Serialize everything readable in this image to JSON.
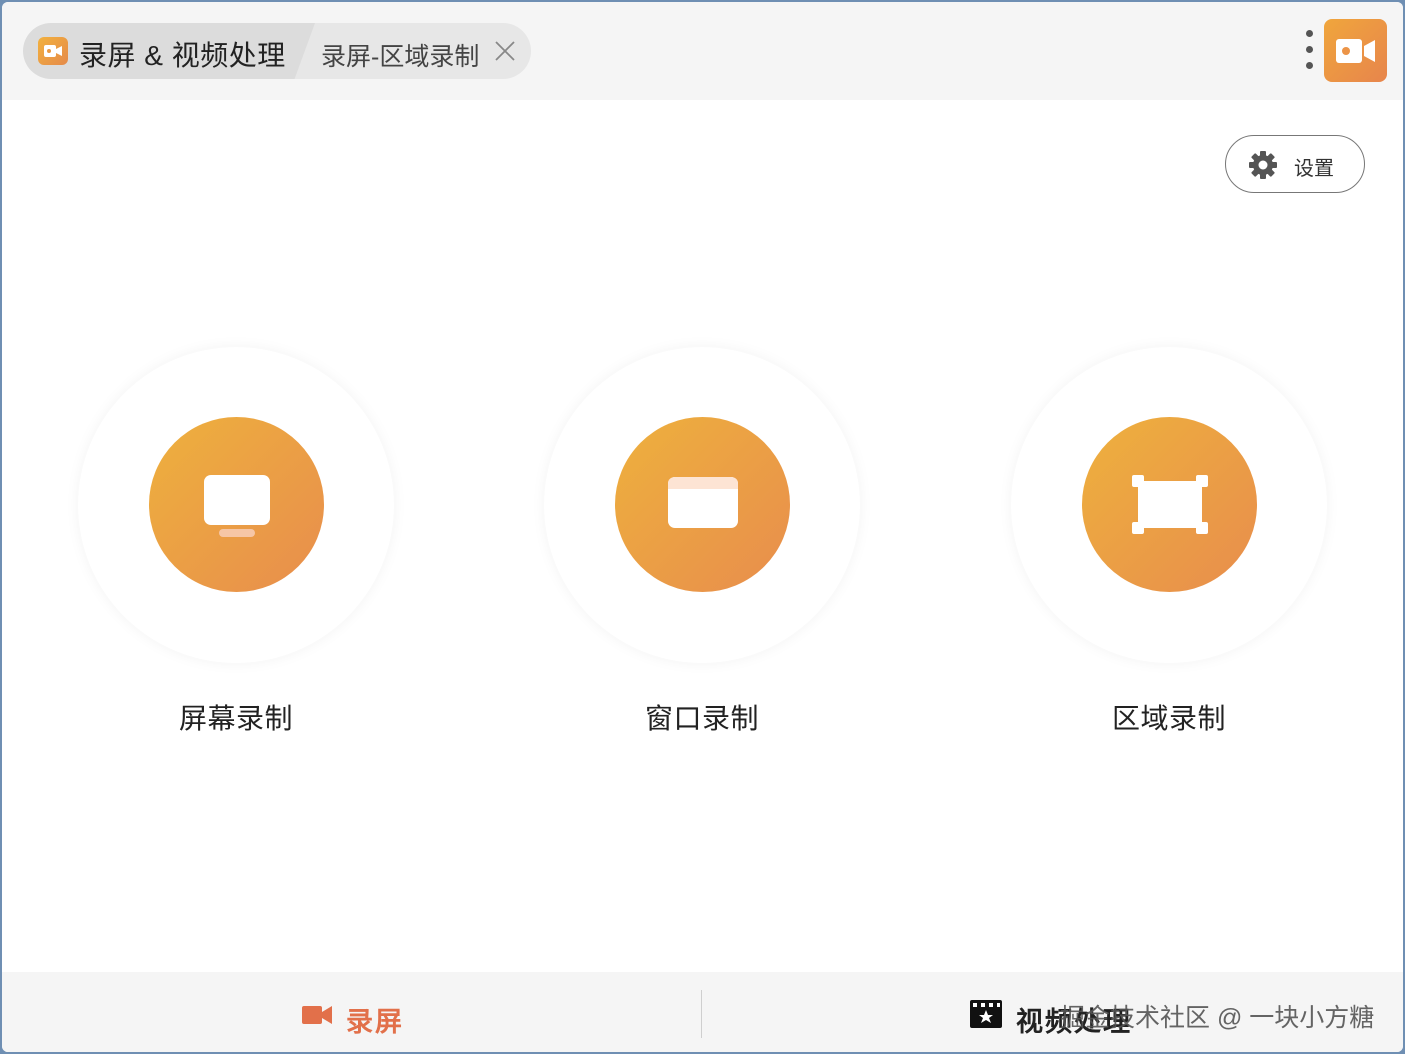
{
  "header": {
    "main_tab_label": "录屏 & 视频处理",
    "sub_tab_label": "录屏-区域录制"
  },
  "settings": {
    "label": "设置"
  },
  "modes": [
    {
      "label": "屏幕录制",
      "icon": "monitor-icon"
    },
    {
      "label": "窗口录制",
      "icon": "window-icon"
    },
    {
      "label": "区域录制",
      "icon": "region-select-icon"
    }
  ],
  "bottom_nav": {
    "record_label": "录屏",
    "video_label": "视频处理"
  },
  "watermark": "掘金技术社区 @ 一块小方糖",
  "colors": {
    "accent_start": "#eeb13d",
    "accent_end": "#e88d4d",
    "active_nav": "#e2704a"
  }
}
